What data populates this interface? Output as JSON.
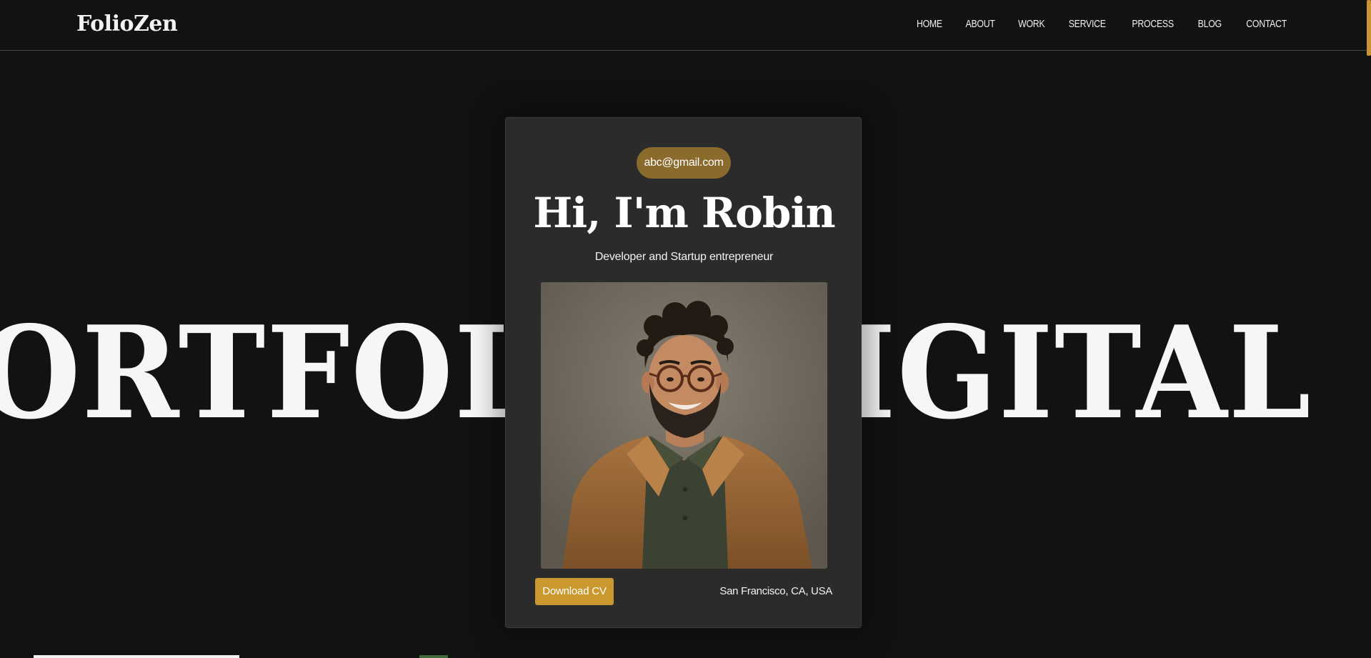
{
  "header": {
    "logo": "FolioZen",
    "nav": [
      "HOME",
      "ABOUT",
      "WORK",
      "SERVICE",
      "PROCESS",
      "BLOG",
      "CONTACT"
    ]
  },
  "hero": {
    "background_text_left": "ORTFOL",
    "background_text_right": "DIGITAL"
  },
  "card": {
    "email": "abc@gmail.com",
    "title": "Hi, I'm Robin",
    "subtitle": "Developer and Startup entrepreneur",
    "portrait_icon": "portrait-photo",
    "download_label": "Download CV",
    "location": "San Francisco, CA, USA"
  },
  "colors": {
    "background": "#121212",
    "card": "#2b2b2b",
    "accent": "#c9982f",
    "pill": "#8b6b2b"
  }
}
